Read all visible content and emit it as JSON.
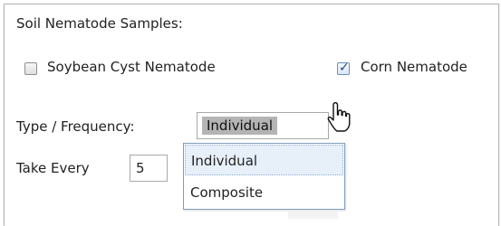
{
  "section_title": "Soil Nematode Samples:",
  "checkboxes": [
    {
      "label": "Soybean Cyst Nematode",
      "checked": false
    },
    {
      "label": "Corn Nematode",
      "checked": true
    }
  ],
  "type_frequency": {
    "label": "Type / Frequency:",
    "selected": "Individual",
    "options": [
      "Individual",
      "Composite"
    ],
    "highlighted_option": "Individual"
  },
  "take_every": {
    "label": "Take Every",
    "value": "5"
  },
  "icons": {
    "checkmark": "check-icon",
    "cursor": "hand-pointer-icon"
  },
  "colors": {
    "checked_accent": "#2b4a7c",
    "dropdown_border": "#7f9db9",
    "selected_bg": "#b4b4b4"
  }
}
